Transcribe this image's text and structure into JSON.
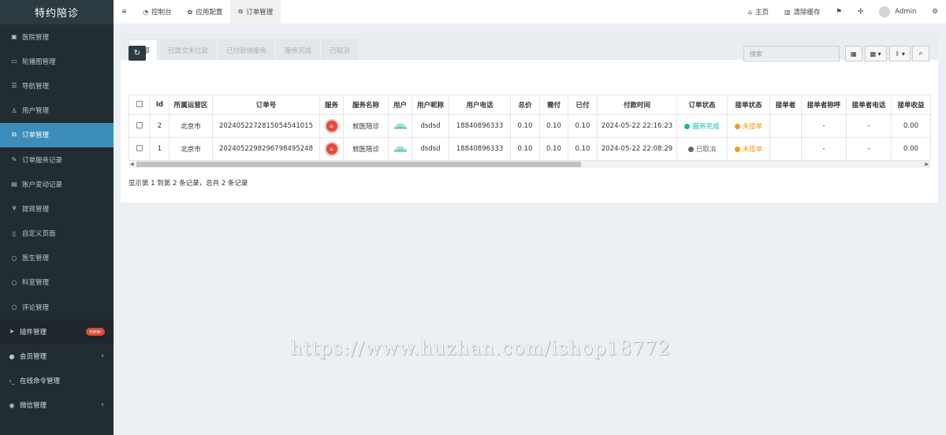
{
  "app": {
    "title": "特约陪诊"
  },
  "sidebar": {
    "items": [
      {
        "label": "医院管理",
        "icon": "hospital-icon"
      },
      {
        "label": "轮播图管理",
        "icon": "image-icon"
      },
      {
        "label": "导航管理",
        "icon": "list-icon"
      },
      {
        "label": "用户管理",
        "icon": "user-icon"
      },
      {
        "label": "订单管理",
        "icon": "order-icon",
        "active": true
      },
      {
        "label": "订单服务记录",
        "icon": "record-icon"
      },
      {
        "label": "账户变动记录",
        "icon": "account-icon"
      },
      {
        "label": "提现管理",
        "icon": "yen-icon"
      },
      {
        "label": "自定义页面",
        "icon": "page-icon"
      },
      {
        "label": "医生管理",
        "icon": "circle-icon"
      },
      {
        "label": "科室管理",
        "icon": "circle-icon"
      },
      {
        "label": "评论管理",
        "icon": "circle-icon"
      }
    ],
    "groups": [
      {
        "label": "插件管理",
        "badge": "new"
      },
      {
        "label": "会员管理"
      },
      {
        "label": "在线命令管理"
      },
      {
        "label": "微信管理"
      }
    ]
  },
  "topbar": {
    "menu": "≡",
    "tabs": [
      "控制台",
      "应用配置",
      "订单管理"
    ],
    "right": {
      "home": "主页",
      "clear_cache": "清除缓存",
      "user": "Admin"
    }
  },
  "filter_tabs": [
    "全部",
    "已提交未付款",
    "已付款待服务",
    "服务完成",
    "已取消"
  ],
  "search": {
    "placeholder": "搜索"
  },
  "table": {
    "columns": [
      "Id",
      "所属运营区",
      "订单号",
      "服务",
      "服务名称",
      "用户",
      "用户昵称",
      "用户电话",
      "总价",
      "需付",
      "已付",
      "付款时间",
      "订单状态",
      "接单状态",
      "接单者",
      "接单者称呼",
      "接单者电话",
      "接单收益"
    ],
    "rows": [
      {
        "id": "2",
        "region": "北京市",
        "order_no": "2024052272815054541015",
        "service_name": "就医陪诊",
        "nickname": "dsdsd",
        "phone": "18840896333",
        "total": "0.10",
        "due": "0.10",
        "paid": "0.10",
        "pay_time": "2024-05-22 22:16:23",
        "order_status": "服务完成",
        "accept_status": "未接单",
        "taker": "",
        "taker_name": "-",
        "taker_phone": "-",
        "income": "0.00"
      },
      {
        "id": "1",
        "region": "北京市",
        "order_no": "2024052298296798495248",
        "service_name": "就医陪诊",
        "nickname": "dsdsd",
        "phone": "18840896333",
        "total": "0.10",
        "due": "0.10",
        "paid": "0.10",
        "pay_time": "2024-05-22 22:08:29",
        "order_status": "已取消",
        "accept_status": "未接单",
        "taker": "",
        "taker_name": "-",
        "taker_phone": "-",
        "income": "0.00"
      }
    ]
  },
  "pager": {
    "text": "显示第 1 到第 2 条记录，总共 2 条记录"
  },
  "watermark": "https://www.huzhan.com/ishop18772",
  "colors": {
    "sidebar": "#222d32",
    "active": "#3c8dbc",
    "green": "#18bc9c",
    "orange": "#f39c12",
    "badge": "#dd4b39"
  }
}
